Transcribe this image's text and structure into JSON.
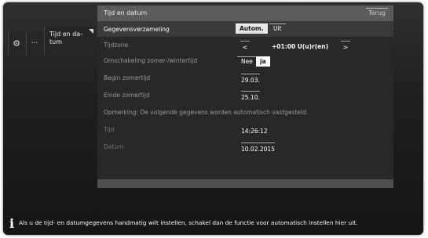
{
  "nav": {
    "gear_icon": "gear-icon",
    "more_label": "...",
    "tab_label_line1": "Tijd en da-",
    "tab_label_line2": "tum"
  },
  "panel": {
    "title": "Tijd en datum",
    "back_label": "Terug"
  },
  "rows": {
    "data_collection": {
      "label": "Gegevensverzameling",
      "options": [
        "Autom.",
        "Uit"
      ],
      "selected": "Autom."
    },
    "timezone": {
      "label": "Tijdzone",
      "left_arrow": "<",
      "value": "+01:00 U(u)r(en)",
      "right_arrow": ">"
    },
    "dst_switch": {
      "label": "Omschakeling zomer-/wintertijd",
      "options": [
        "Nee",
        "ja"
      ],
      "selected": "ja"
    },
    "dst_begin": {
      "label": "Begin zomertijd",
      "value": "29.03."
    },
    "dst_end": {
      "label": "Einde zomertijd",
      "value": "25.10."
    },
    "note": "Opmerking: De volgende gegevens worden automatisch vastgesteld.",
    "time": {
      "label": "Tijd",
      "value": "14:26:12"
    },
    "date": {
      "label": "Datum",
      "value": "10.02.2015"
    }
  },
  "info": {
    "icon": "info-icon",
    "text": "Als u de tijd- en datumgegevens handmatig wilt instellen, schakel dan de functie voor automatisch instellen hier uit."
  }
}
